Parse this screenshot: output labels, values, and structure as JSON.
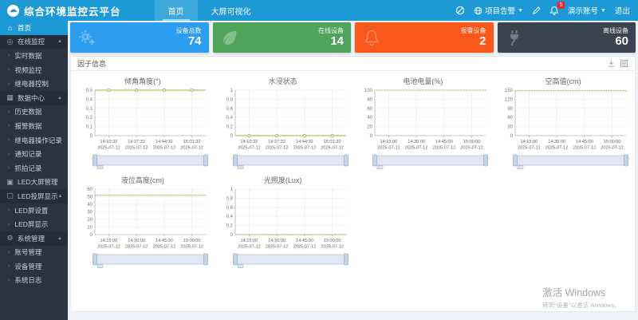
{
  "navbar": {
    "title": "综合环境监控云平台",
    "menus": [
      {
        "label": "首页",
        "active": true
      },
      {
        "label": "大屏可视化",
        "active": false
      }
    ],
    "alarm_label": "项目告警",
    "badge_count": "5",
    "account": "演示账号",
    "logout": "退出"
  },
  "sidebar": {
    "items": [
      {
        "id": "home",
        "label": "首页",
        "icon": "home-icon",
        "type": "root",
        "active": true
      },
      {
        "id": "online-monitor",
        "label": "在线监控",
        "icon": "monitor-icon",
        "type": "group"
      },
      {
        "id": "realtime-data",
        "label": "实时数据",
        "type": "sub"
      },
      {
        "id": "video-monitor",
        "label": "视频监控",
        "type": "sub"
      },
      {
        "id": "relay-control",
        "label": "继电器控制",
        "type": "sub"
      },
      {
        "id": "data-center",
        "label": "数据中心",
        "icon": "data-icon",
        "type": "group"
      },
      {
        "id": "history-data",
        "label": "历史数据",
        "type": "sub"
      },
      {
        "id": "alarm-data",
        "label": "报警数据",
        "type": "sub"
      },
      {
        "id": "relay-op-log",
        "label": "继电器操作记录",
        "type": "sub"
      },
      {
        "id": "notify-log",
        "label": "通知记录",
        "type": "sub"
      },
      {
        "id": "snapshot-log",
        "label": "抓拍记录",
        "type": "sub"
      },
      {
        "id": "led-screen-mgmt",
        "label": "LED大屏管理",
        "icon": "led-icon",
        "type": "root"
      },
      {
        "id": "led-cast",
        "label": "LED投屏显示",
        "icon": "screen-icon",
        "type": "group"
      },
      {
        "id": "led-setting",
        "label": "LED屏设置",
        "type": "sub"
      },
      {
        "id": "led-display",
        "label": "LED屏显示",
        "type": "sub"
      },
      {
        "id": "system-mgmt",
        "label": "系统管理",
        "icon": "gear-icon",
        "type": "group"
      },
      {
        "id": "account-mgmt",
        "label": "账号管理",
        "type": "sub"
      },
      {
        "id": "device-mgmt",
        "label": "设备管理",
        "type": "sub"
      },
      {
        "id": "system-log",
        "label": "系统日志",
        "type": "sub"
      }
    ]
  },
  "stat_cards": [
    {
      "id": "device-total",
      "label": "设备总数",
      "value": "74",
      "color": "#2d9df0",
      "icon": "gears-icon"
    },
    {
      "id": "device-online",
      "label": "在线设备",
      "value": "14",
      "color": "#4fa35a",
      "icon": "leaf-icon"
    },
    {
      "id": "device-alarm",
      "label": "报警设备",
      "value": "2",
      "color": "#fa571d",
      "icon": "bell-icon"
    },
    {
      "id": "device-offline",
      "label": "离线设备",
      "value": "60",
      "color": "#3a4450",
      "icon": "plug-icon"
    }
  ],
  "panel": {
    "title": "因子信息",
    "tools": [
      "download-icon",
      "dataview-icon"
    ]
  },
  "chart_data": [
    {
      "type": "line",
      "title": "倾角角度(°)",
      "x": [
        "14:10:32",
        "14:27:32",
        "14:44:32",
        "15:01:32"
      ],
      "date": "2025-07-12",
      "ylim": [
        0,
        0.5
      ],
      "yticks": [
        0,
        0.1,
        0.2,
        0.3,
        0.4,
        0.5
      ],
      "values": [
        0.5,
        0.5,
        0.5,
        0.5
      ],
      "color": "#9db342",
      "markers": true,
      "dense": false,
      "grid": true
    },
    {
      "type": "line",
      "title": "水浸状态",
      "x": [
        "14:10:32",
        "14:27:32",
        "14:44:32",
        "15:01:32"
      ],
      "date": "2025-07-12",
      "ylim": [
        0,
        1
      ],
      "yticks": [
        0,
        0.2,
        0.4,
        0.6,
        0.8,
        1
      ],
      "values": [
        0,
        0,
        0,
        0
      ],
      "color": "#9db342",
      "markers": true,
      "dense": false,
      "grid": true
    },
    {
      "type": "line",
      "title": "电池电量(%)",
      "x": [
        "14:15:00",
        "14:30:00",
        "14:45:00",
        "15:00:00"
      ],
      "date": "2025-07-12",
      "ylim": [
        0,
        100
      ],
      "yticks": [
        0,
        20,
        40,
        60,
        80,
        100
      ],
      "values": [
        100,
        100,
        100,
        100
      ],
      "color": "#9db342",
      "markers": false,
      "dense": true,
      "grid": true
    },
    {
      "type": "line",
      "title": "空高值(cm)",
      "x": [
        "14:15:00",
        "14:30:00",
        "14:45:00",
        "15:00:00"
      ],
      "date": "2025-07-12",
      "ylim": [
        0,
        150
      ],
      "yticks": [
        0,
        30,
        60,
        90,
        120,
        150
      ],
      "values": [
        148,
        148,
        148,
        148
      ],
      "color": "#9db342",
      "markers": false,
      "dense": true,
      "grid": true
    },
    {
      "type": "line",
      "title": "液位高度(cm)",
      "x": [
        "14:15:00",
        "14:30:00",
        "14:45:00",
        "15:00:00"
      ],
      "date": "2025-07-12",
      "ylim": [
        0,
        60
      ],
      "yticks": [
        0,
        10,
        20,
        30,
        40,
        50,
        60
      ],
      "values": [
        52,
        52,
        52,
        52
      ],
      "color": "#9db342",
      "markers": false,
      "dense": true,
      "grid": true
    },
    {
      "type": "line",
      "title": "光照度(Lux)",
      "x": [
        "14:15:00",
        "14:30:00",
        "14:45:00",
        "15:00:00"
      ],
      "date": "2025-07-12",
      "ylim": [
        0,
        1
      ],
      "yticks": [
        0,
        0.2,
        0.4,
        0.6,
        0.8,
        1
      ],
      "values": [
        0,
        0,
        0,
        0
      ],
      "color": "#9db342",
      "markers": false,
      "dense": true,
      "grid": true
    }
  ],
  "watermark": {
    "line1": "激活 Windows",
    "line2": "转到\"设置\"以激活 Windows。"
  }
}
